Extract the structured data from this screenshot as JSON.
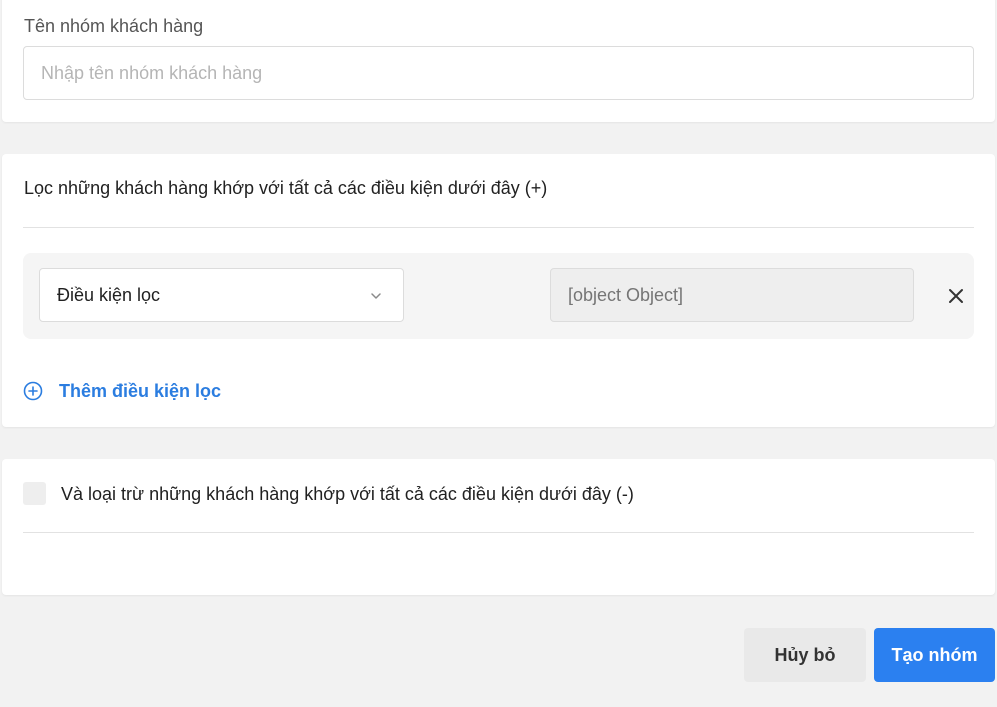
{
  "group_name": {
    "label": "Tên nhóm khách hàng",
    "placeholder": "Nhập tên nhóm khách hàng",
    "value": ""
  },
  "include_section": {
    "title": "Lọc những khách hàng khớp với tất cả các điều kiện dưới đây (+)",
    "conditions": [
      {
        "field_selected": "Điều kiện lọc",
        "value_placeholder": "[object Object]"
      }
    ],
    "add_filter_label": "Thêm điều kiện lọc"
  },
  "exclude_section": {
    "checked": false,
    "title": "Và loại trừ những khách hàng khớp với tất cả các điều kiện dưới đây (-)"
  },
  "actions": {
    "cancel_label": "Hủy bỏ",
    "create_label": "Tạo nhóm"
  },
  "colors": {
    "accent": "#2b80f0",
    "link": "#2b7de0",
    "background": "#f2f2f2"
  },
  "icons": {
    "select_chevron": "chevron-down-icon",
    "remove": "close-icon",
    "add": "plus-circle-icon"
  }
}
